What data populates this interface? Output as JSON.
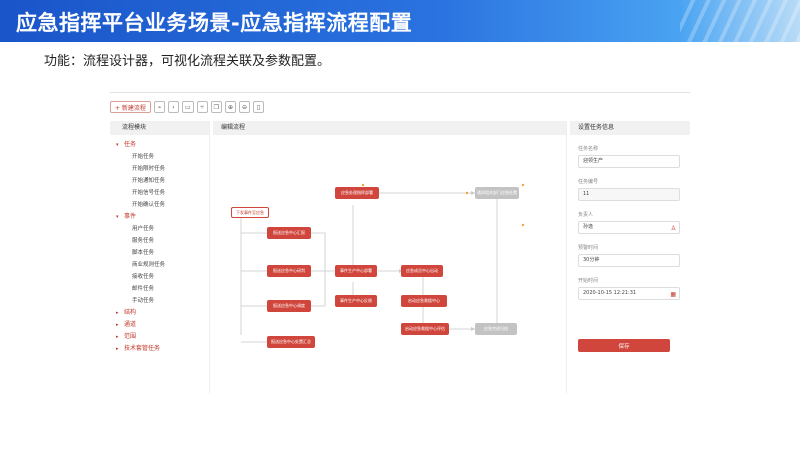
{
  "slide": {
    "title": "应急指挥平台业务场景-应急指挥流程配置",
    "subtitle": "功能：流程设计器，可视化流程关联及参数配置。"
  },
  "toolbar": {
    "new_flow_label": "+ 新建流程",
    "icons": [
      "flow-icon",
      "back-icon",
      "layout-icon",
      "branch-icon",
      "copy-icon",
      "zoom-in-icon",
      "zoom-out-icon",
      "delete-icon"
    ]
  },
  "left_panel": {
    "title": "流程模块",
    "groups": [
      {
        "label": "任务",
        "expanded": true,
        "items": [
          "开始任务",
          "开始限时任务",
          "开始通知任务",
          "开始信号任务",
          "开始确认任务"
        ]
      },
      {
        "label": "事件",
        "expanded": true,
        "items": [
          "用户任务",
          "服务任务",
          "脚本任务",
          "商业规则任务",
          "接收任务",
          "邮件任务",
          "手动任务"
        ]
      },
      {
        "label": "结构",
        "expanded": false,
        "items": []
      },
      {
        "label": "通道",
        "expanded": false,
        "items": []
      },
      {
        "label": "范围",
        "expanded": false,
        "items": []
      },
      {
        "label": "技术套管任务",
        "expanded": false,
        "items": []
      }
    ]
  },
  "mid_panel": {
    "title": "编辑流程",
    "nodes": {
      "start": "下发事件至应急",
      "a1": "报送应急中心汇报",
      "a2": "报送应急中心研判",
      "a3": "报送应急中心调度",
      "a4": "报送应急中心处置汇总",
      "b0": "应急处理指挥部署",
      "b1": "事件生产中心部署",
      "b2": "事件生产中心反馈",
      "c1": "应急成员中心出动",
      "c2": "启动应急救援中心",
      "c3": "启动应急救援中心评估",
      "g1": "通知相关部门应急处置",
      "g2": "应急完成归档"
    }
  },
  "right_panel": {
    "title": "设置任务信息",
    "fields": [
      {
        "label": "任务名称",
        "value": "迎领生产"
      },
      {
        "label": "任务编号",
        "value": "11"
      },
      {
        "label": "负责人",
        "value": "孙逸"
      },
      {
        "label": "预警时间",
        "value": "30分钟"
      },
      {
        "label": "开始时间",
        "value": "2020-10-15  12:21:31"
      }
    ],
    "save_label": "保存"
  },
  "colors": {
    "accent": "#d0463c",
    "banner_start": "#1a55c9",
    "banner_end": "#4aa3f2",
    "disabled_node": "#c3c3c3"
  }
}
